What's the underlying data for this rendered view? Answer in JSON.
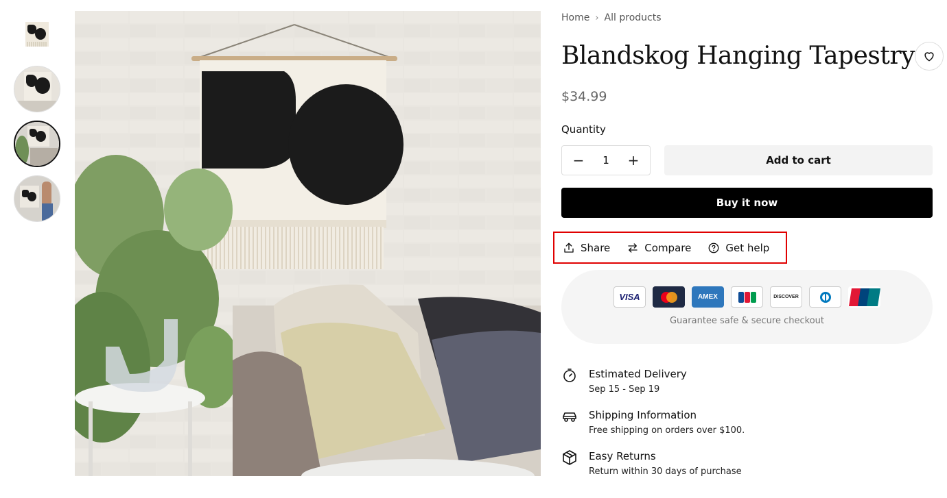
{
  "breadcrumb": {
    "home": "Home",
    "current": "All products"
  },
  "product": {
    "title": "Blandskog Hanging Tapestry",
    "price": "$34.99"
  },
  "quantity": {
    "label": "Quantity",
    "value": "1",
    "minus": "−",
    "plus": "+"
  },
  "buttons": {
    "add_to_cart": "Add to cart",
    "buy_now": "Buy it now"
  },
  "actions": [
    {
      "label": "Share",
      "icon": "share-icon"
    },
    {
      "label": "Compare",
      "icon": "compare-icon"
    },
    {
      "label": "Get help",
      "icon": "help-icon"
    }
  ],
  "payment": {
    "cards": [
      "VISA",
      "Mastercard",
      "AMEX",
      "JCB",
      "DISCOVER",
      "Diners",
      "UnionPay"
    ],
    "text": "Guarantee safe & secure checkout"
  },
  "features": [
    {
      "title": "Estimated Delivery",
      "sub": "Sep 15 - Sep 19",
      "icon": "stopwatch-icon"
    },
    {
      "title": "Shipping Information",
      "sub": "Free shipping on orders over $100.",
      "icon": "car-icon"
    },
    {
      "title": "Easy Returns",
      "sub": "Return within 30 days of purchase",
      "icon": "box-icon"
    }
  ],
  "colors": {
    "accent": "#000000",
    "highlight_border": "#e00000",
    "secure_bg": "#f5f5f5"
  }
}
